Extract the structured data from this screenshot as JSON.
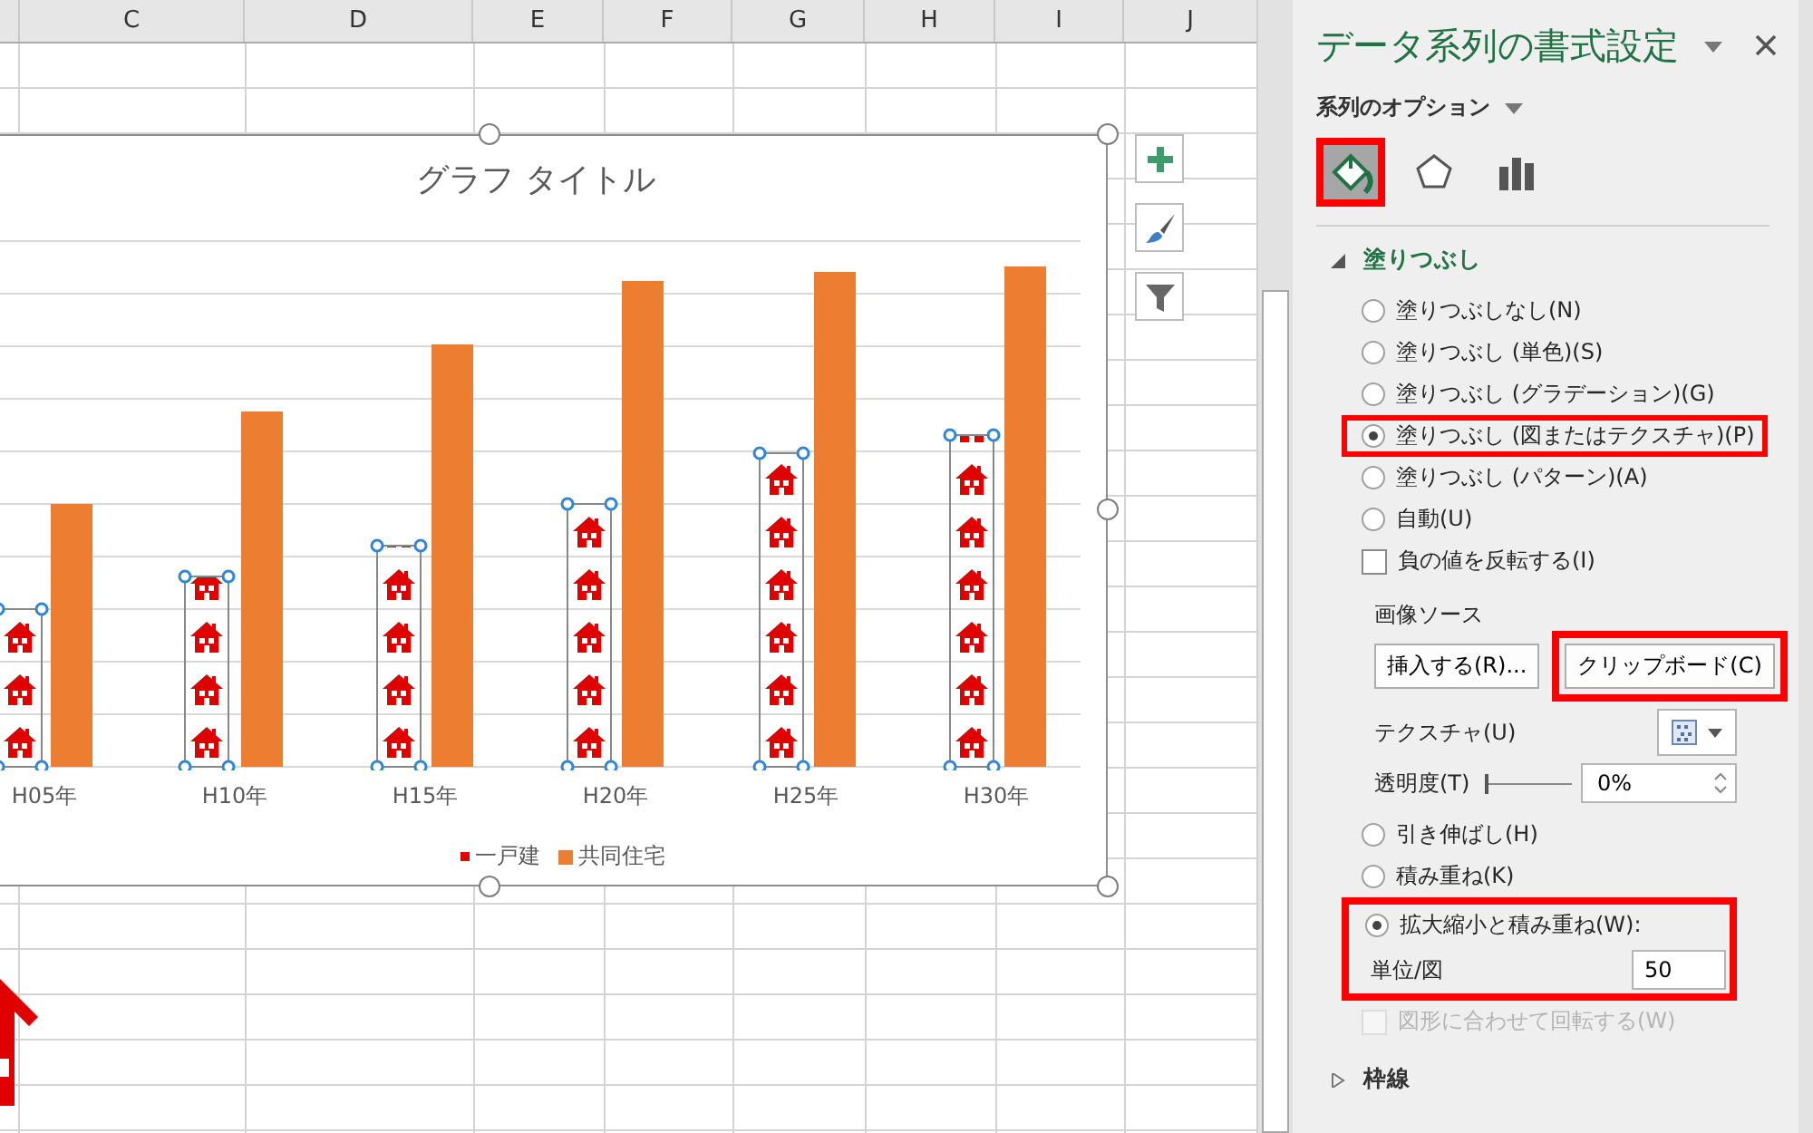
{
  "sheet": {
    "columns": [
      "C",
      "D",
      "E",
      "F",
      "G",
      "H",
      "I",
      "J"
    ]
  },
  "chart": {
    "title": "グラフ タイトル",
    "categories": [
      "H05年",
      "H10年",
      "H15年",
      "H20年",
      "H25年",
      "H30年"
    ],
    "legend": [
      {
        "label": "一戸建",
        "kind": "picture",
        "color": "#e00000"
      },
      {
        "label": "共同住宅",
        "kind": "bar",
        "color": "#ed7d31"
      }
    ]
  },
  "panel": {
    "title": "データ系列の書式設定",
    "subtitle": "系列のオプション",
    "icon_tabs": [
      {
        "kind": "fill",
        "selected": true,
        "highlighted": true
      },
      {
        "kind": "effects",
        "selected": false,
        "highlighted": false
      },
      {
        "kind": "series",
        "selected": false,
        "highlighted": false
      }
    ],
    "fill": {
      "label": "塗りつぶし",
      "expanded": true,
      "options": [
        {
          "label": "塗りつぶしなし(N)",
          "selected": false,
          "highlighted": false
        },
        {
          "label": "塗りつぶし (単色)(S)",
          "selected": false,
          "highlighted": false
        },
        {
          "label": "塗りつぶし (グラデーション)(G)",
          "selected": false,
          "highlighted": false
        },
        {
          "label": "塗りつぶし (図またはテクスチャ)(P)",
          "selected": true,
          "highlighted": true
        },
        {
          "label": "塗りつぶし (パターン)(A)",
          "selected": false,
          "highlighted": false
        },
        {
          "label": "自動(U)",
          "selected": false,
          "highlighted": false
        }
      ],
      "invert": {
        "label": "負の値を反転する(I)",
        "checked": false
      },
      "image_source_label": "画像ソース",
      "buttons": [
        {
          "label": "挿入する(R)...",
          "highlighted": false
        },
        {
          "label": "クリップボード(C)",
          "highlighted": true
        }
      ],
      "texture_label": "テクスチャ(U)",
      "transparency": {
        "label": "透明度(T)",
        "level": 0,
        "value": "0%"
      },
      "tiling": [
        {
          "label": "引き伸ばし(H)",
          "selected": false,
          "highlighted": false
        },
        {
          "label": "積み重ね(K)",
          "selected": false,
          "highlighted": false
        },
        {
          "label": "拡大縮小と積み重ね(W):",
          "selected": true,
          "highlighted": true
        }
      ],
      "unit": {
        "label": "単位/図",
        "value": "50"
      },
      "rotate": {
        "label": "図形に合わせて回転する(W)",
        "checked": false,
        "disabled": true
      }
    },
    "border": {
      "label": "枠線",
      "expanded": false
    }
  }
}
